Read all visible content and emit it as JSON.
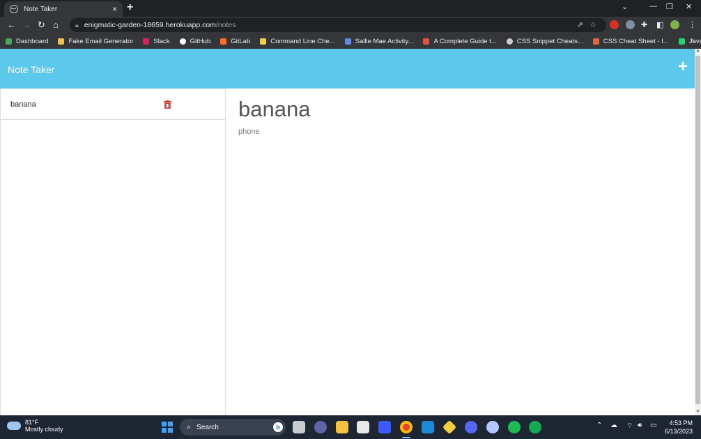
{
  "browser": {
    "tab_title": "Note Taker",
    "tab_close": "×",
    "new_tab": "+",
    "url_host": "enigmatic-garden-18659.herokuapp.com",
    "url_path": "/notes"
  },
  "bookmarks": [
    {
      "label": "Dashboard",
      "color": "#4aa564"
    },
    {
      "label": "Fake Email Generator",
      "color": "#f0c24a"
    },
    {
      "label": "Slack",
      "color": "#e01e5a"
    },
    {
      "label": "GitHub",
      "color": "#ffffff"
    },
    {
      "label": "GitLab",
      "color": "#fc6d26"
    },
    {
      "label": "Command Line Che...",
      "color": "#f4d03f"
    },
    {
      "label": "Sallie Mae Activity...",
      "color": "#5b8def"
    },
    {
      "label": "A Complete Guide t...",
      "color": "#e74c3c"
    },
    {
      "label": "CSS Snippet Cheats...",
      "color": "#cccccc"
    },
    {
      "label": "CSS Cheat Sheet - I...",
      "color": "#e8633a"
    },
    {
      "label": "JavaScript Operators",
      "color": "#2ecc71"
    }
  ],
  "bookmarks_more": "»",
  "app": {
    "brand": "Note Taker",
    "add_button": "+",
    "notes": [
      {
        "title": "banana"
      }
    ],
    "active_note": {
      "title": "banana",
      "text": "phone"
    }
  },
  "taskbar": {
    "temperature": "81°F",
    "condition": "Mostly cloudy",
    "search_label": "Search",
    "time": "4:53 PM",
    "date": "6/13/2023"
  }
}
